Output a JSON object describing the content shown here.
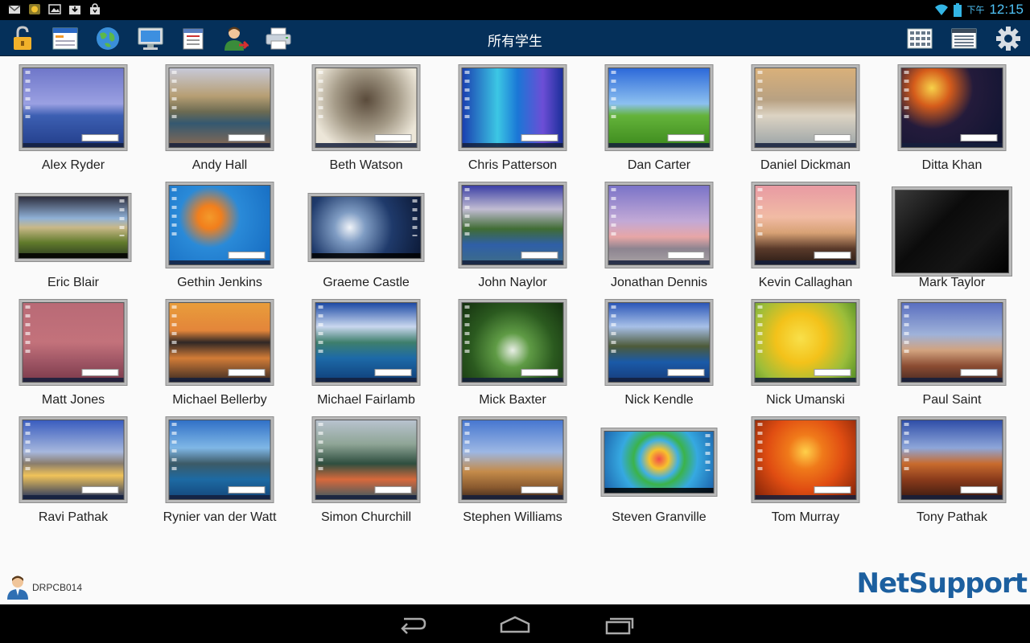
{
  "status_bar": {
    "left_icons": [
      "gmail-icon",
      "notification-app-icon",
      "gallery-icon",
      "download-icon",
      "shopping-bag-icon"
    ],
    "ampm": "下午",
    "time": "12:15"
  },
  "toolbar": {
    "title": "所有学生",
    "left_buttons": [
      "lock-icon",
      "window-icon",
      "globe-icon",
      "monitor-icon",
      "notepad-icon",
      "user-icon",
      "printer-icon"
    ],
    "right_buttons": [
      "grid-view-icon",
      "list-view-icon",
      "gear-icon"
    ]
  },
  "students": [
    {
      "name": "Alex Ryder",
      "shape": "p",
      "bg": "linear-gradient(#6f77c9 0%,#9aa0e2 45%,#3c5fb2 60%,#233e8b 100%)"
    },
    {
      "name": "Andy Hall",
      "shape": "p",
      "bg": "linear-gradient(#c7c9d8 0%,#b79f74 35%,#6d6b52 55%,#345870 70%,#8a6a52 100%)"
    },
    {
      "name": "Beth Watson",
      "shape": "p",
      "bg": "radial-gradient(circle at 50% 40%,#5a4b3b 0%,#a59b88 45%,#ece6d8 80%)"
    },
    {
      "name": "Chris Patterson",
      "shape": "p",
      "bg": "linear-gradient(90deg,#1a3fb0 0%,#3cc7e4 35%,#1a77d6 55%,#6c4ed6 80%,#1b2f9a 100%)"
    },
    {
      "name": "Dan Carter",
      "shape": "p",
      "bg": "linear-gradient(#2d69d9 0%,#8cc0f0 45%,#64b33a 60%,#3c8a1d 100%)"
    },
    {
      "name": "Daniel Dickman",
      "shape": "p",
      "bg": "linear-gradient(#d9b07a 0%,#b8a182 40%,#dcd3c3 60%,#9aa3a6 100%)"
    },
    {
      "name": "Ditta Khan",
      "shape": "p",
      "bg": "radial-gradient(circle at 30% 25%,#f7d24a 0%,#d55c1b 20%,#241b3b 45%,#0d1330 100%)"
    },
    {
      "name": "Eric Blair",
      "shape": "l",
      "bg": "linear-gradient(#2e2f3f 0%,#8fb0d6 35%,#c9b888 50%,#607a2b 75%,#2b3a22 100%)"
    },
    {
      "name": "Gethin Jenkins",
      "shape": "p",
      "bg": "radial-gradient(circle at 40% 40%,#f39a2b 0%,#f27f1c 15%,#2a8ad8 40%,#1469bf 100%)"
    },
    {
      "name": "Graeme Castle",
      "shape": "l",
      "bg": "radial-gradient(circle at 35% 50%,#f1f4f9 0%,#7f9cc3 20%,#1f3a6b 55%,#0c1936 100%)"
    },
    {
      "name": "John Naylor",
      "shape": "p",
      "bg": "linear-gradient(#3b3fa5 0%,#c1bcd2 30%,#406c34 55%,#2f5fa7 75%,#3e6d87 100%)"
    },
    {
      "name": "Jonathan Dennis",
      "shape": "p",
      "bg": "linear-gradient(#7a73c8 0%,#c2a9d6 45%,#e7a6a6 65%,#8d8490 80%,#a9a3a5 100%)"
    },
    {
      "name": "Kevin Callaghan",
      "shape": "p",
      "bg": "linear-gradient(#e89aa3 0%,#f1bba4 40%,#d7a174 60%,#5a3a2a 80%,#2a1c16 100%)"
    },
    {
      "name": "Mark Taylor",
      "shape": "lt",
      "bg": "linear-gradient(135deg,#3a3a3a 0%,#0b0b0b 40%,#151515 70%,#000 100%)"
    },
    {
      "name": "Matt Jones",
      "shape": "p",
      "bg": "linear-gradient(#b96a76 0%,#c3727b 50%,#9e5564 75%,#7b3a4a 100%)"
    },
    {
      "name": "Michael Bellerby",
      "shape": "p",
      "bg": "linear-gradient(#e99d3b 0%,#e3853a 35%,#2f2725 50%,#d27c37 70%,#3a2a23 100%)"
    },
    {
      "name": "Michael Fairlamb",
      "shape": "p",
      "bg": "linear-gradient(#1d4aa5 0%,#c9d7ef 30%,#3e7f6c 50%,#1d6aa8 70%,#0f3e79 100%)"
    },
    {
      "name": "Mick Baxter",
      "shape": "p",
      "bg": "radial-gradient(circle at 50% 60%,#e9efe6 0%,#5f9b45 25%,#2b5a1f 60%,#14300f 100%)"
    },
    {
      "name": "Nick Kendle",
      "shape": "p",
      "bg": "linear-gradient(#2c57b8 0%,#a7c0e7 30%,#4d5a39 55%,#1a5aa8 75%,#173c7a 100%)"
    },
    {
      "name": "Nick Umanski",
      "shape": "p",
      "bg": "radial-gradient(circle at 45% 45%,#f8e04a 0%,#f3c21a 35%,#9bbd3a 70%,#4d8a26 100%)"
    },
    {
      "name": "Paul Saint",
      "shape": "p",
      "bg": "linear-gradient(#5a6fc0 0%,#9fb2d9 40%,#d2a37f 60%,#8b4c32 80%,#4a2a23 100%)"
    },
    {
      "name": "Ravi Pathak",
      "shape": "p",
      "bg": "linear-gradient(#3a5dbf 0%,#a6b7dd 40%,#8a7d6c 55%,#f0c35a 70%,#21315e 100%)"
    },
    {
      "name": "Rynier van der Watt",
      "shape": "p",
      "bg": "linear-gradient(#3171c7 0%,#7fb7e6 35%,#3c5a66 55%,#1d6aa3 75%,#14467a 100%)"
    },
    {
      "name": "Simon Churchill",
      "shape": "p",
      "bg": "linear-gradient(#b8c3cf 0%,#8fa596 30%,#2e4e3f 55%,#d7693c 75%,#3b5a62 100%)"
    },
    {
      "name": "Stephen Williams",
      "shape": "p",
      "bg": "linear-gradient(#4777d0 0%,#9cb7e4 40%,#c48b4a 65%,#8a5a2f 85%,#402a1c 100%)"
    },
    {
      "name": "Steven Granville",
      "shape": "l",
      "bg": "radial-gradient(circle at 50% 45%,#f14b4b 0%,#f7c22d 15%,#3fb0e3 30%,#3bb34a 40%,#36a9e1 60%,#1b5fa8 100%)"
    },
    {
      "name": "Tom Murray",
      "shape": "p",
      "bg": "radial-gradient(circle at 50% 40%,#ffd04a 0%,#f07a1a 25%,#e04d12 55%,#7e2108 100%)"
    },
    {
      "name": "Tony Pathak",
      "shape": "p",
      "bg": "linear-gradient(#2f4ea8 0%,#8ea6d9 35%,#c86b2e 55%,#8a3b1b 75%,#3b1a10 100%)"
    }
  ],
  "footer": {
    "username": "DRPCB014",
    "logo_text": "NetSupport"
  },
  "nav": [
    "back-icon",
    "home-icon",
    "recent-apps-icon"
  ]
}
